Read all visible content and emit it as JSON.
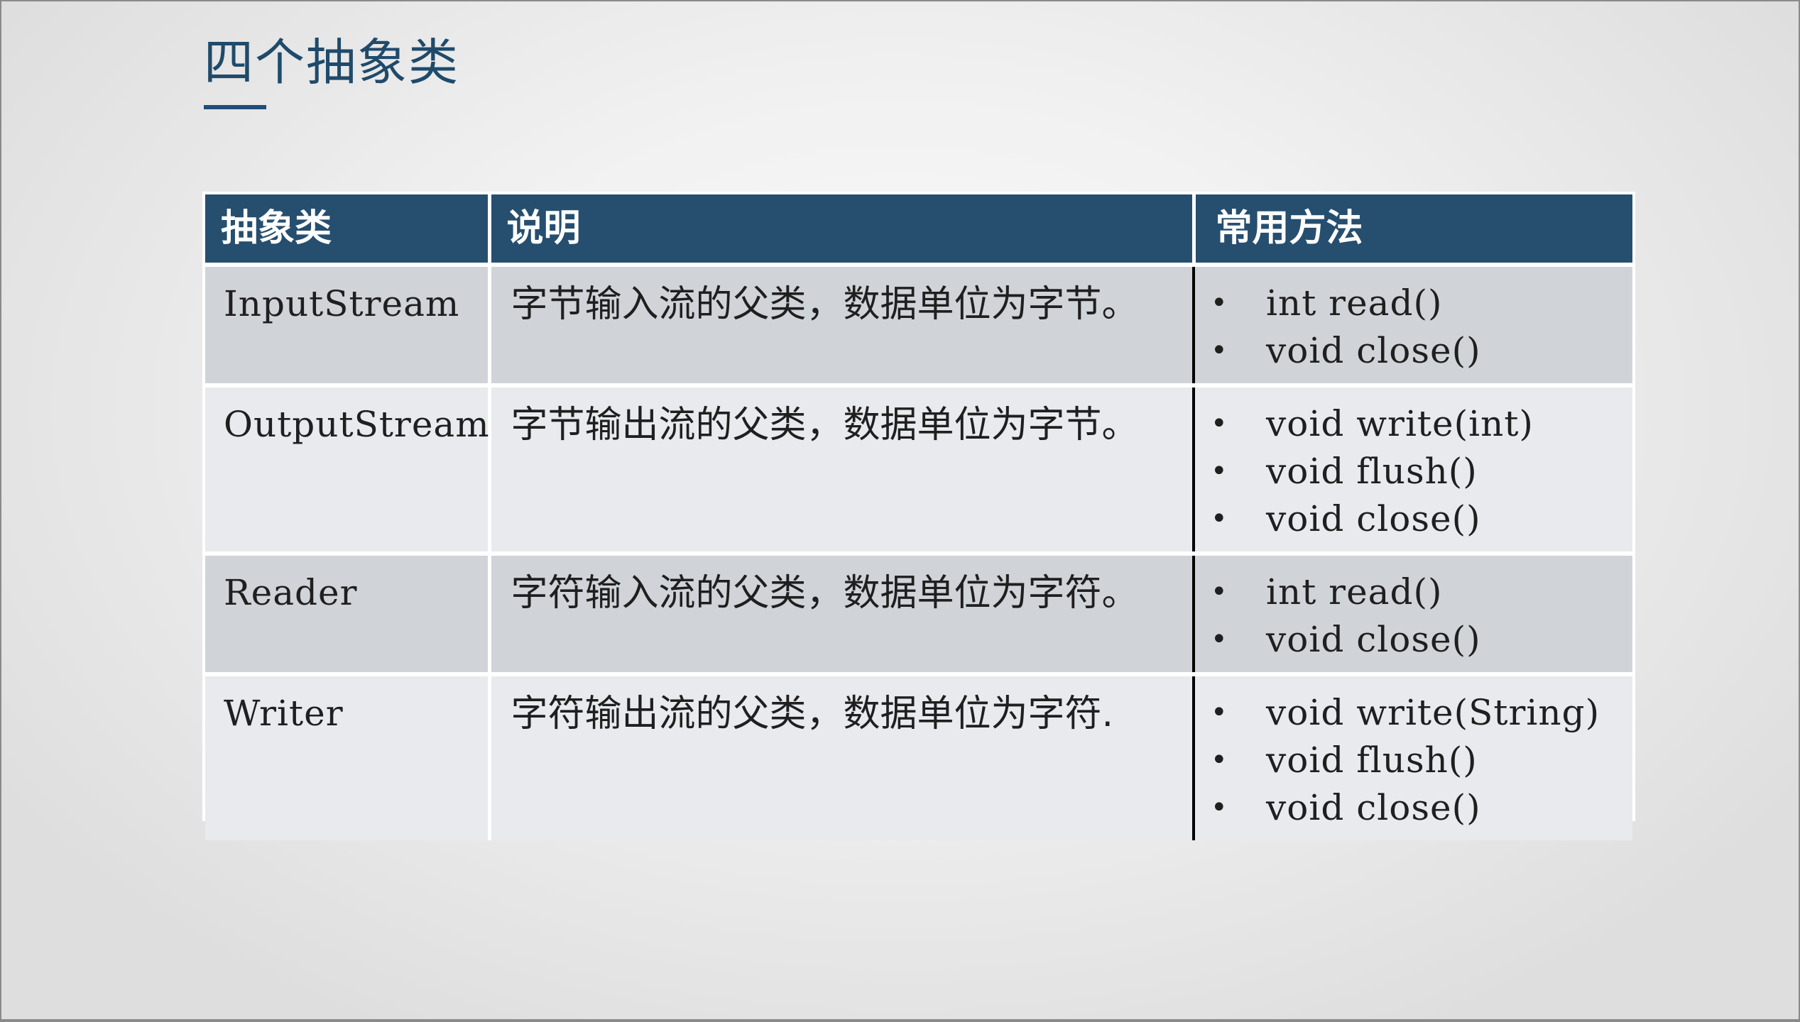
{
  "title": "四个抽象类",
  "table": {
    "headers": [
      "抽象类",
      "说明",
      "常用方法"
    ],
    "rows": [
      {
        "name": "InputStream",
        "description": "字节输入流的父类，数据单位为字节。",
        "methods": [
          "int read()",
          "void close()"
        ]
      },
      {
        "name": "OutputStream",
        "description": "字节输出流的父类，数据单位为字节。",
        "methods": [
          "void write(int)",
          "void flush()",
          "void close()"
        ]
      },
      {
        "name": "Reader",
        "description": "字符输入流的父类，数据单位为字符。",
        "methods": [
          "int read()",
          "void close()"
        ]
      },
      {
        "name": "Writer",
        "description": "字符输出流的父类，数据单位为字符.",
        "methods": [
          "void write(String)",
          "void flush()",
          "void close()"
        ]
      }
    ]
  },
  "bullet_glyph": "•",
  "colors": {
    "header_bg": "#264e6f",
    "title": "#1f4a6b",
    "row_shade": "#d0d4d9",
    "row_light": "#e8eaed"
  }
}
